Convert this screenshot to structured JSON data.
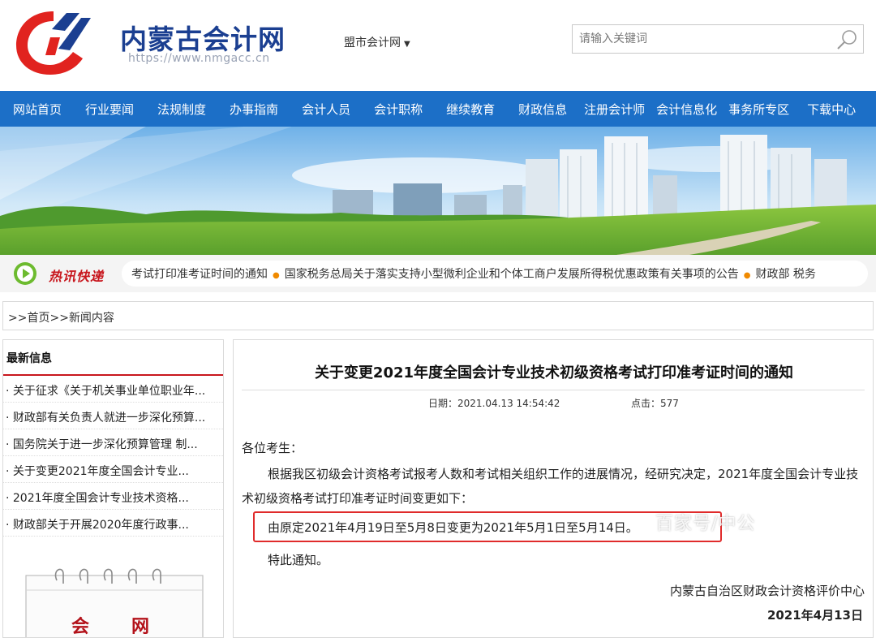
{
  "header": {
    "site_name": "内蒙古会计网",
    "site_url": "https://www.nmgacc.cn",
    "city_select": "盟市会计网",
    "search_placeholder": "请输入关键词"
  },
  "nav": {
    "items": [
      "网站首页",
      "行业要闻",
      "法规制度",
      "办事指南",
      "会计人员",
      "会计职称",
      "继续教育",
      "财政信息",
      "注册会计师",
      "会计信息化",
      "事务所专区",
      "下载中心"
    ]
  },
  "ticker": {
    "label": "热讯快递",
    "items": [
      "考试打印准考证时间的通知",
      "国家税务总局关于落实支持小型微利企业和个体工商户发展所得税优惠政策有关事项的公告",
      "财政部 税务"
    ]
  },
  "breadcrumb": {
    "prefix": ">>",
    "home": "首页",
    "current": "新闻内容"
  },
  "sidebar": {
    "title": "最新信息",
    "items": [
      "· 关于征求《关于机关事业单位职业年...",
      "· 财政部有关负责人就进一步深化预算...",
      "· 国务院关于进一步深化预算管理 制...",
      "· 关于变更2021年度全国会计专业...",
      "· 2021年度全国会计专业技术资格...",
      "· 财政部关于开展2020年度行政事..."
    ],
    "calendar_chars": [
      "会",
      "网"
    ]
  },
  "article": {
    "title": "关于变更2021年度全国会计专业技术初级资格考试打印准考证时间的通知",
    "date_label": "日期：",
    "date_value": "2021.04.13 14:54:42",
    "clicks_label": "点击：",
    "clicks_value": "577",
    "greeting": "各位考生：",
    "paragraph": "根据我区初级会计资格考试报考人数和考试相关组织工作的进展情况，经研究决定，2021年度全国会计专业技术初级资格考试打印准考证时间变更如下：",
    "highlight": "由原定2021年4月19日至5月8日变更为2021年5月1日至5月14日。",
    "notice": "特此通知。",
    "signature": "内蒙古自治区财政会计资格评价中心",
    "sign_date": "2021年4月13日"
  },
  "watermark": "百家号/中公",
  "colors": {
    "brand_blue": "#1b3f91",
    "nav_blue": "#1c6fc7",
    "accent_red": "#c8161d",
    "highlight_red": "#e02b2b"
  }
}
